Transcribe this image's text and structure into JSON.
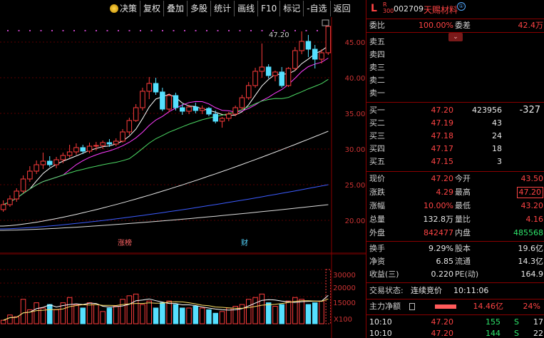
{
  "toolbar": {
    "items": [
      "决策",
      "复权",
      "叠加",
      "多股",
      "统计",
      "画线",
      "F10",
      "标记",
      "-自选",
      "返回"
    ]
  },
  "chart": {
    "price_ticks": [
      "45.00",
      "40.00",
      "35.00",
      "30.00",
      "25.00",
      "20.00"
    ],
    "high_label": "47.20",
    "event_labels": [
      "涨榜",
      "财"
    ],
    "vol_ticks": [
      "30000",
      "20000",
      "15000"
    ],
    "vol_unit": "X100"
  },
  "stock": {
    "board": "L",
    "index_tag_top": "R",
    "index_tag_bottom": "300",
    "code": "002709",
    "name": "天赐材料",
    "info_icon": "①"
  },
  "ratio": {
    "label1": "委比",
    "value1": "100.00%",
    "label2": "委差",
    "value2": "42.4万"
  },
  "asks": [
    {
      "label": "卖五"
    },
    {
      "label": "卖四"
    },
    {
      "label": "卖三"
    },
    {
      "label": "卖二"
    },
    {
      "label": "卖一"
    }
  ],
  "bids": [
    {
      "label": "买一",
      "price": "47.20",
      "vol": "423956",
      "extra": "-327"
    },
    {
      "label": "买二",
      "price": "47.19",
      "vol": "43",
      "extra": ""
    },
    {
      "label": "买三",
      "price": "47.18",
      "vol": "24",
      "extra": ""
    },
    {
      "label": "买四",
      "price": "47.17",
      "vol": "18",
      "extra": ""
    },
    {
      "label": "买五",
      "price": "47.15",
      "vol": "3",
      "extra": ""
    }
  ],
  "quote": [
    {
      "l1": "现价",
      "v1": "47.20",
      "l2": "今开",
      "v2": "43.50"
    },
    {
      "l1": "涨跌",
      "v1": "4.29",
      "l2": "最高",
      "v2": "47.20"
    },
    {
      "l1": "涨幅",
      "v1": "10.00%",
      "l2": "最低",
      "v2": "43.20"
    },
    {
      "l1": "总量",
      "v1": "132.8万",
      "l2": "量比",
      "v2": "4.16"
    },
    {
      "l1": "外盘",
      "v1": "842477",
      "l2": "内盘",
      "v2": "485568"
    }
  ],
  "fundamentals": [
    {
      "l1": "换手",
      "v1": "9.29%",
      "l2": "股本",
      "v2": "19.6亿"
    },
    {
      "l1": "净资",
      "v1": "6.85",
      "l2": "流通",
      "v2": "14.3亿"
    },
    {
      "l1": "收益(三)",
      "v1": "0.220",
      "l2": "PE(动)",
      "v2": "164.9"
    }
  ],
  "trade_state": {
    "label": "交易状态:",
    "value": "连续竞价",
    "time": "10:11:06"
  },
  "main_flow": {
    "label": "主力净额",
    "value": "14.46亿",
    "pct": "24%"
  },
  "ticks": [
    {
      "time": "10:10",
      "price": "47.20",
      "vol": "155",
      "side": "S",
      "n": "17"
    },
    {
      "time": "10:10",
      "price": "47.20",
      "vol": "144",
      "side": "S",
      "n": "22"
    }
  ],
  "chart_data": {
    "type": "candlestick",
    "price_range": [
      18.5,
      48.5
    ],
    "candles": [
      [
        21.5,
        22.8,
        21.2,
        22.2
      ],
      [
        22.2,
        23.5,
        21.9,
        23.0
      ],
      [
        23.0,
        24.5,
        22.6,
        24.1
      ],
      [
        24.1,
        26.3,
        23.8,
        25.8
      ],
      [
        25.8,
        27.6,
        25.4,
        26.9
      ],
      [
        26.9,
        28.4,
        26.5,
        27.8
      ],
      [
        27.8,
        29.5,
        27.2,
        28.3
      ],
      [
        28.3,
        29.0,
        27.5,
        27.8
      ],
      [
        27.8,
        28.9,
        27.3,
        28.5
      ],
      [
        28.5,
        29.5,
        28.0,
        29.1
      ],
      [
        29.1,
        30.6,
        28.8,
        29.6
      ],
      [
        29.6,
        30.8,
        29.2,
        30.2
      ],
      [
        30.2,
        30.6,
        29.3,
        29.7
      ],
      [
        29.7,
        30.9,
        29.4,
        30.4
      ],
      [
        30.4,
        31.0,
        29.8,
        30.5
      ],
      [
        30.5,
        31.2,
        30.0,
        30.9
      ],
      [
        30.9,
        31.4,
        30.3,
        30.7
      ],
      [
        30.7,
        31.5,
        30.4,
        31.1
      ],
      [
        31.1,
        32.8,
        30.9,
        32.4
      ],
      [
        32.4,
        34.4,
        32.0,
        34.0
      ],
      [
        34.0,
        36.3,
        33.8,
        35.8
      ],
      [
        35.8,
        38.6,
        35.4,
        38.1
      ],
      [
        38.1,
        40.1,
        37.0,
        39.2
      ],
      [
        39.2,
        40.0,
        37.6,
        38.0
      ],
      [
        38.0,
        38.6,
        35.3,
        35.6
      ],
      [
        35.6,
        37.8,
        35.2,
        37.5
      ],
      [
        37.5,
        37.9,
        35.4,
        35.8
      ],
      [
        35.8,
        36.3,
        34.8,
        35.3
      ],
      [
        35.3,
        36.2,
        34.9,
        35.9
      ],
      [
        35.9,
        36.5,
        35.0,
        35.4
      ],
      [
        35.4,
        36.1,
        34.9,
        35.7
      ],
      [
        35.7,
        35.9,
        34.6,
        34.9
      ],
      [
        34.9,
        35.4,
        33.6,
        33.9
      ],
      [
        33.9,
        34.5,
        33.0,
        34.3
      ],
      [
        34.3,
        35.2,
        33.9,
        34.9
      ],
      [
        34.9,
        36.1,
        34.6,
        35.8
      ],
      [
        35.8,
        37.6,
        35.5,
        37.2
      ],
      [
        37.2,
        39.4,
        36.9,
        38.9
      ],
      [
        38.9,
        41.4,
        38.6,
        40.9
      ],
      [
        40.9,
        44.8,
        40.0,
        41.5
      ],
      [
        41.5,
        41.9,
        39.9,
        40.3
      ],
      [
        40.3,
        41.0,
        39.5,
        40.8
      ],
      [
        40.8,
        41.5,
        38.6,
        38.9
      ],
      [
        38.9,
        41.5,
        38.7,
        41.3
      ],
      [
        41.3,
        44.3,
        41.0,
        43.8
      ],
      [
        43.8,
        46.5,
        43.3,
        45.1
      ],
      [
        45.1,
        46.0,
        42.9,
        44.0
      ],
      [
        44.0,
        44.6,
        41.3,
        42.6
      ],
      [
        42.6,
        44.0,
        42.0,
        43.5
      ],
      [
        43.5,
        47.2,
        43.2,
        47.2
      ]
    ],
    "volumes": [
      2,
      5,
      4,
      14,
      8,
      12,
      9,
      11,
      8,
      12,
      15,
      11,
      9,
      12,
      11,
      7,
      9,
      10,
      14,
      16,
      17,
      11,
      13,
      9,
      12,
      13,
      11,
      9,
      9,
      10,
      9,
      8,
      6,
      7,
      9,
      10,
      11,
      14,
      15,
      17,
      12,
      10,
      11,
      13,
      15,
      14,
      11,
      12,
      13,
      31
    ]
  }
}
